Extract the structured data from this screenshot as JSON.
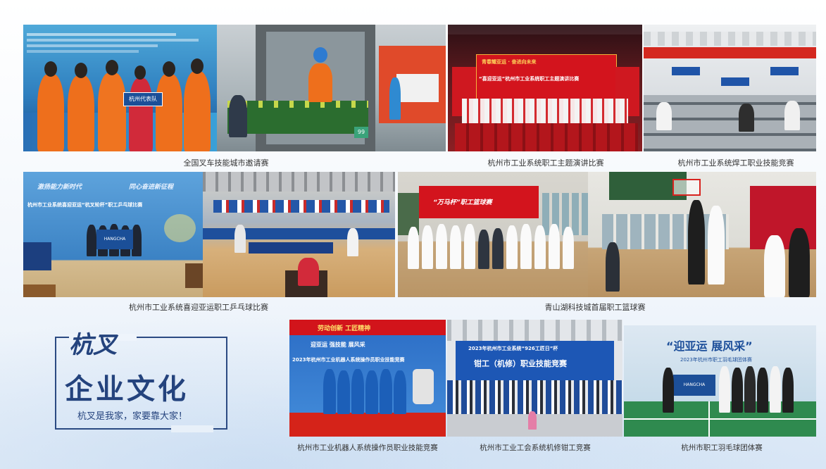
{
  "colors": {
    "navy": "#24437d",
    "orange": "#e8701e",
    "banner_red": "#c5151e",
    "banner_blue": "#1e4fa6"
  },
  "captions": {
    "forklift": "全国叉车技能城市邀请赛",
    "speech": "杭州市工业系统职工主题演讲比赛",
    "welding": "杭州市工业系统焊工职业技能竞赛",
    "pingpong": "杭州市工业系统喜迎亚运职工乒乓球比赛",
    "basketball": "青山湖科技城首届职工篮球赛",
    "robot": "杭州市工业机器人系统操作员职业技能竞赛",
    "fitter": "杭州市工业工会系统机修钳工竞赛",
    "badminton": "杭州市职工羽毛球团体赛"
  },
  "brand": {
    "name": "杭叉",
    "subtitle": "企业文化",
    "slogan": "杭叉是我家，家要靠大家！"
  },
  "photo_text": {
    "team_sign": "杭州代表队",
    "number_plate": "99",
    "speech_banner_top": "青春耀亚运 · 奋进向未来",
    "speech_banner_main": "“喜迎亚运”杭州市工业系统职工主题演讲比赛",
    "pingpong_banner_left": "激扬能力新时代",
    "pingpong_banner_right": "同心奋进新征程",
    "pingpong_banner_main": "杭州市工业系统喜迎亚运“杭叉轮杯”职工乒乓球比赛",
    "pingpong_team_sign": "HANGCHA",
    "basketball_banner": "“万马杯”职工篮球赛",
    "robot_top_banner": "劳动创新  工匠精神",
    "robot_banner_small": "迎亚运 强技能 展风采",
    "robot_banner_main": "2023年杭州市工业机器人系统操作员职业技能竞赛",
    "fitter_banner_top": "2023年杭州市工业系统“926工匠日”杯",
    "fitter_banner_main": "钳工（机修）职业技能竞赛",
    "badminton_banner": "“迎亚运 展风采”",
    "badminton_sub": "2023年杭州市职工羽毛球团体赛",
    "badminton_team_sign": "HANGCHA"
  }
}
